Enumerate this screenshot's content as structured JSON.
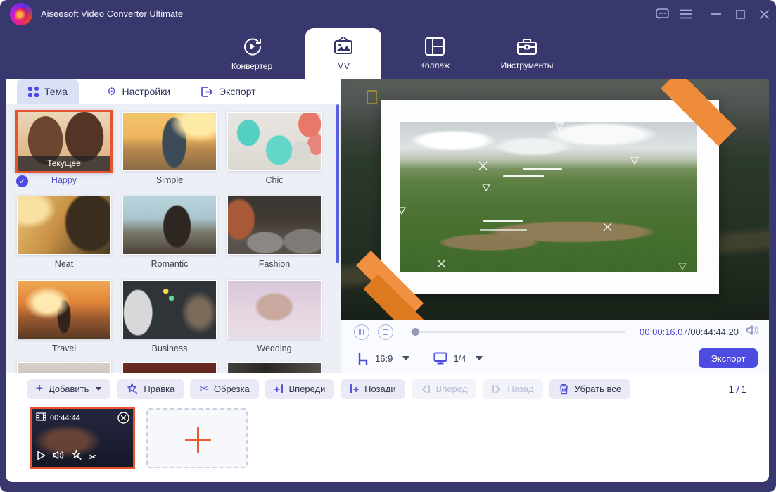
{
  "app": {
    "title": "Aiseesoft Video Converter Ultimate"
  },
  "nav_tabs": [
    {
      "label": "Конвертер"
    },
    {
      "label": "MV",
      "active": true
    },
    {
      "label": "Коллаж"
    },
    {
      "label": "Инструменты"
    }
  ],
  "panel_tabs": [
    {
      "label": "Тема",
      "active": true
    },
    {
      "label": "Настройки"
    },
    {
      "label": "Экспорт"
    }
  ],
  "themes": {
    "current_badge": "Текущее",
    "items": [
      {
        "name": "Happy",
        "selected": true
      },
      {
        "name": "Simple"
      },
      {
        "name": "Chic"
      },
      {
        "name": "Neat"
      },
      {
        "name": "Romantic"
      },
      {
        "name": "Fashion"
      },
      {
        "name": "Travel"
      },
      {
        "name": "Business"
      },
      {
        "name": "Wedding"
      }
    ]
  },
  "preview": {
    "time_current": "00:00:16.07",
    "time_total": "/00:44:44.20",
    "aspect_ratio": "16:9",
    "preview_page": "1/4",
    "export_label": "Экспорт"
  },
  "toolbar": {
    "add": "Добавить",
    "edit": "Правка",
    "trim": "Обрезка",
    "insert_front": "Впереди",
    "insert_behind": "Позади",
    "move_forward": "Вперед",
    "move_back": "Назад",
    "remove_all": "Убрать все",
    "page_current": "1",
    "page_sep": "/",
    "page_total": "1"
  },
  "clip": {
    "duration": "00:44:44"
  },
  "icons": {
    "gear_glyph": "⚙",
    "scissors_glyph": "✂",
    "check_glyph": "✓"
  },
  "colors": {
    "accent": "#4D4BE0",
    "selection_orange": "#E8522E",
    "tape_orange": "#EF8C3A",
    "titlebar_navy": "#38386F",
    "time_accent": "#4A4AD8"
  }
}
